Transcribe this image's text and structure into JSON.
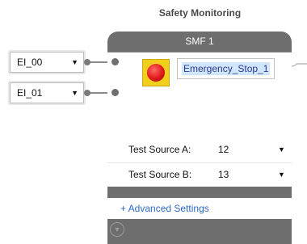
{
  "group_title": "Safety Monitoring",
  "inputs": [
    {
      "value": "EI_00"
    },
    {
      "value": "EI_01"
    }
  ],
  "block": {
    "title": "SMF 1",
    "name": "Emergency_Stop_1",
    "params": [
      {
        "label": "Test Source A:",
        "value": "12"
      },
      {
        "label": "Test Source B:",
        "value": "13"
      }
    ],
    "advanced_link": "+ Advanced Settings"
  },
  "colors": {
    "block_body": "#6e6e6e",
    "link": "#2e68c4",
    "name_text": "#2b3a8f",
    "estop_bg": "#f2cf1d",
    "estop_button": "#e01818"
  },
  "icons": {
    "emergency_stop": "emergency-stop-icon",
    "collapse": "chevron-down-icon",
    "dropdown": "dropdown-arrow-icon"
  }
}
